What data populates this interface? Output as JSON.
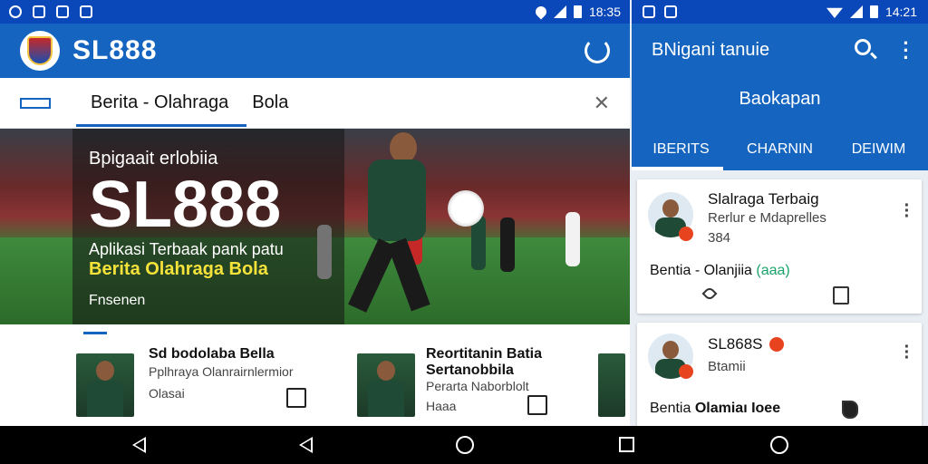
{
  "left": {
    "status": {
      "time": "18:35"
    },
    "appbar": {
      "title": "SL888"
    },
    "tabs": [
      {
        "label": "Berita - Olahraga"
      },
      {
        "label": "Bola"
      }
    ],
    "hero": {
      "subtitle": "Bpigaait erlobiia",
      "big_title": "SL888",
      "description": "Aplikasi Terbaak pank patu",
      "highlight": "Berita Olahraga Bola",
      "link": "Fnsenen"
    },
    "news": [
      {
        "title": "Sd bodolaba Bella",
        "subtitle": "Pplhraya Olanrairnlermior",
        "meta": "Olasai"
      },
      {
        "title": "Reortitanin Batia",
        "title2": "Sertanobbila",
        "subtitle": "Perarta Naborblolt",
        "meta": "Haaa"
      }
    ]
  },
  "right": {
    "status": {
      "time": "14:21"
    },
    "header": {
      "title": "BNigani tanuie",
      "subtitle": "Baokapan"
    },
    "tabs": [
      {
        "label": "IBERITS"
      },
      {
        "label": "CHARNIN"
      },
      {
        "label": "DEIWIM"
      }
    ],
    "cards": [
      {
        "title": "Slalraga Terbaig",
        "subtitle": "Rerlur e Mdaprelles",
        "meta": "384",
        "footer": "Bentia - Olanjiia",
        "footer_tag": "(aaa)"
      },
      {
        "title": "SL868S",
        "subtitle": "Btamii",
        "footer": "Bentia",
        "footer_tag": "Olamiaı Ioee"
      }
    ]
  },
  "colors": {
    "primary": "#1565c0",
    "status_bar": "#0a47b8",
    "accent_yellow": "#f5e23a",
    "badge_red": "#e8431f"
  },
  "icons": [
    "refresh-icon",
    "search-icon",
    "more-icon",
    "close-icon",
    "share-icon",
    "back-icon",
    "home-icon",
    "recents-icon"
  ]
}
